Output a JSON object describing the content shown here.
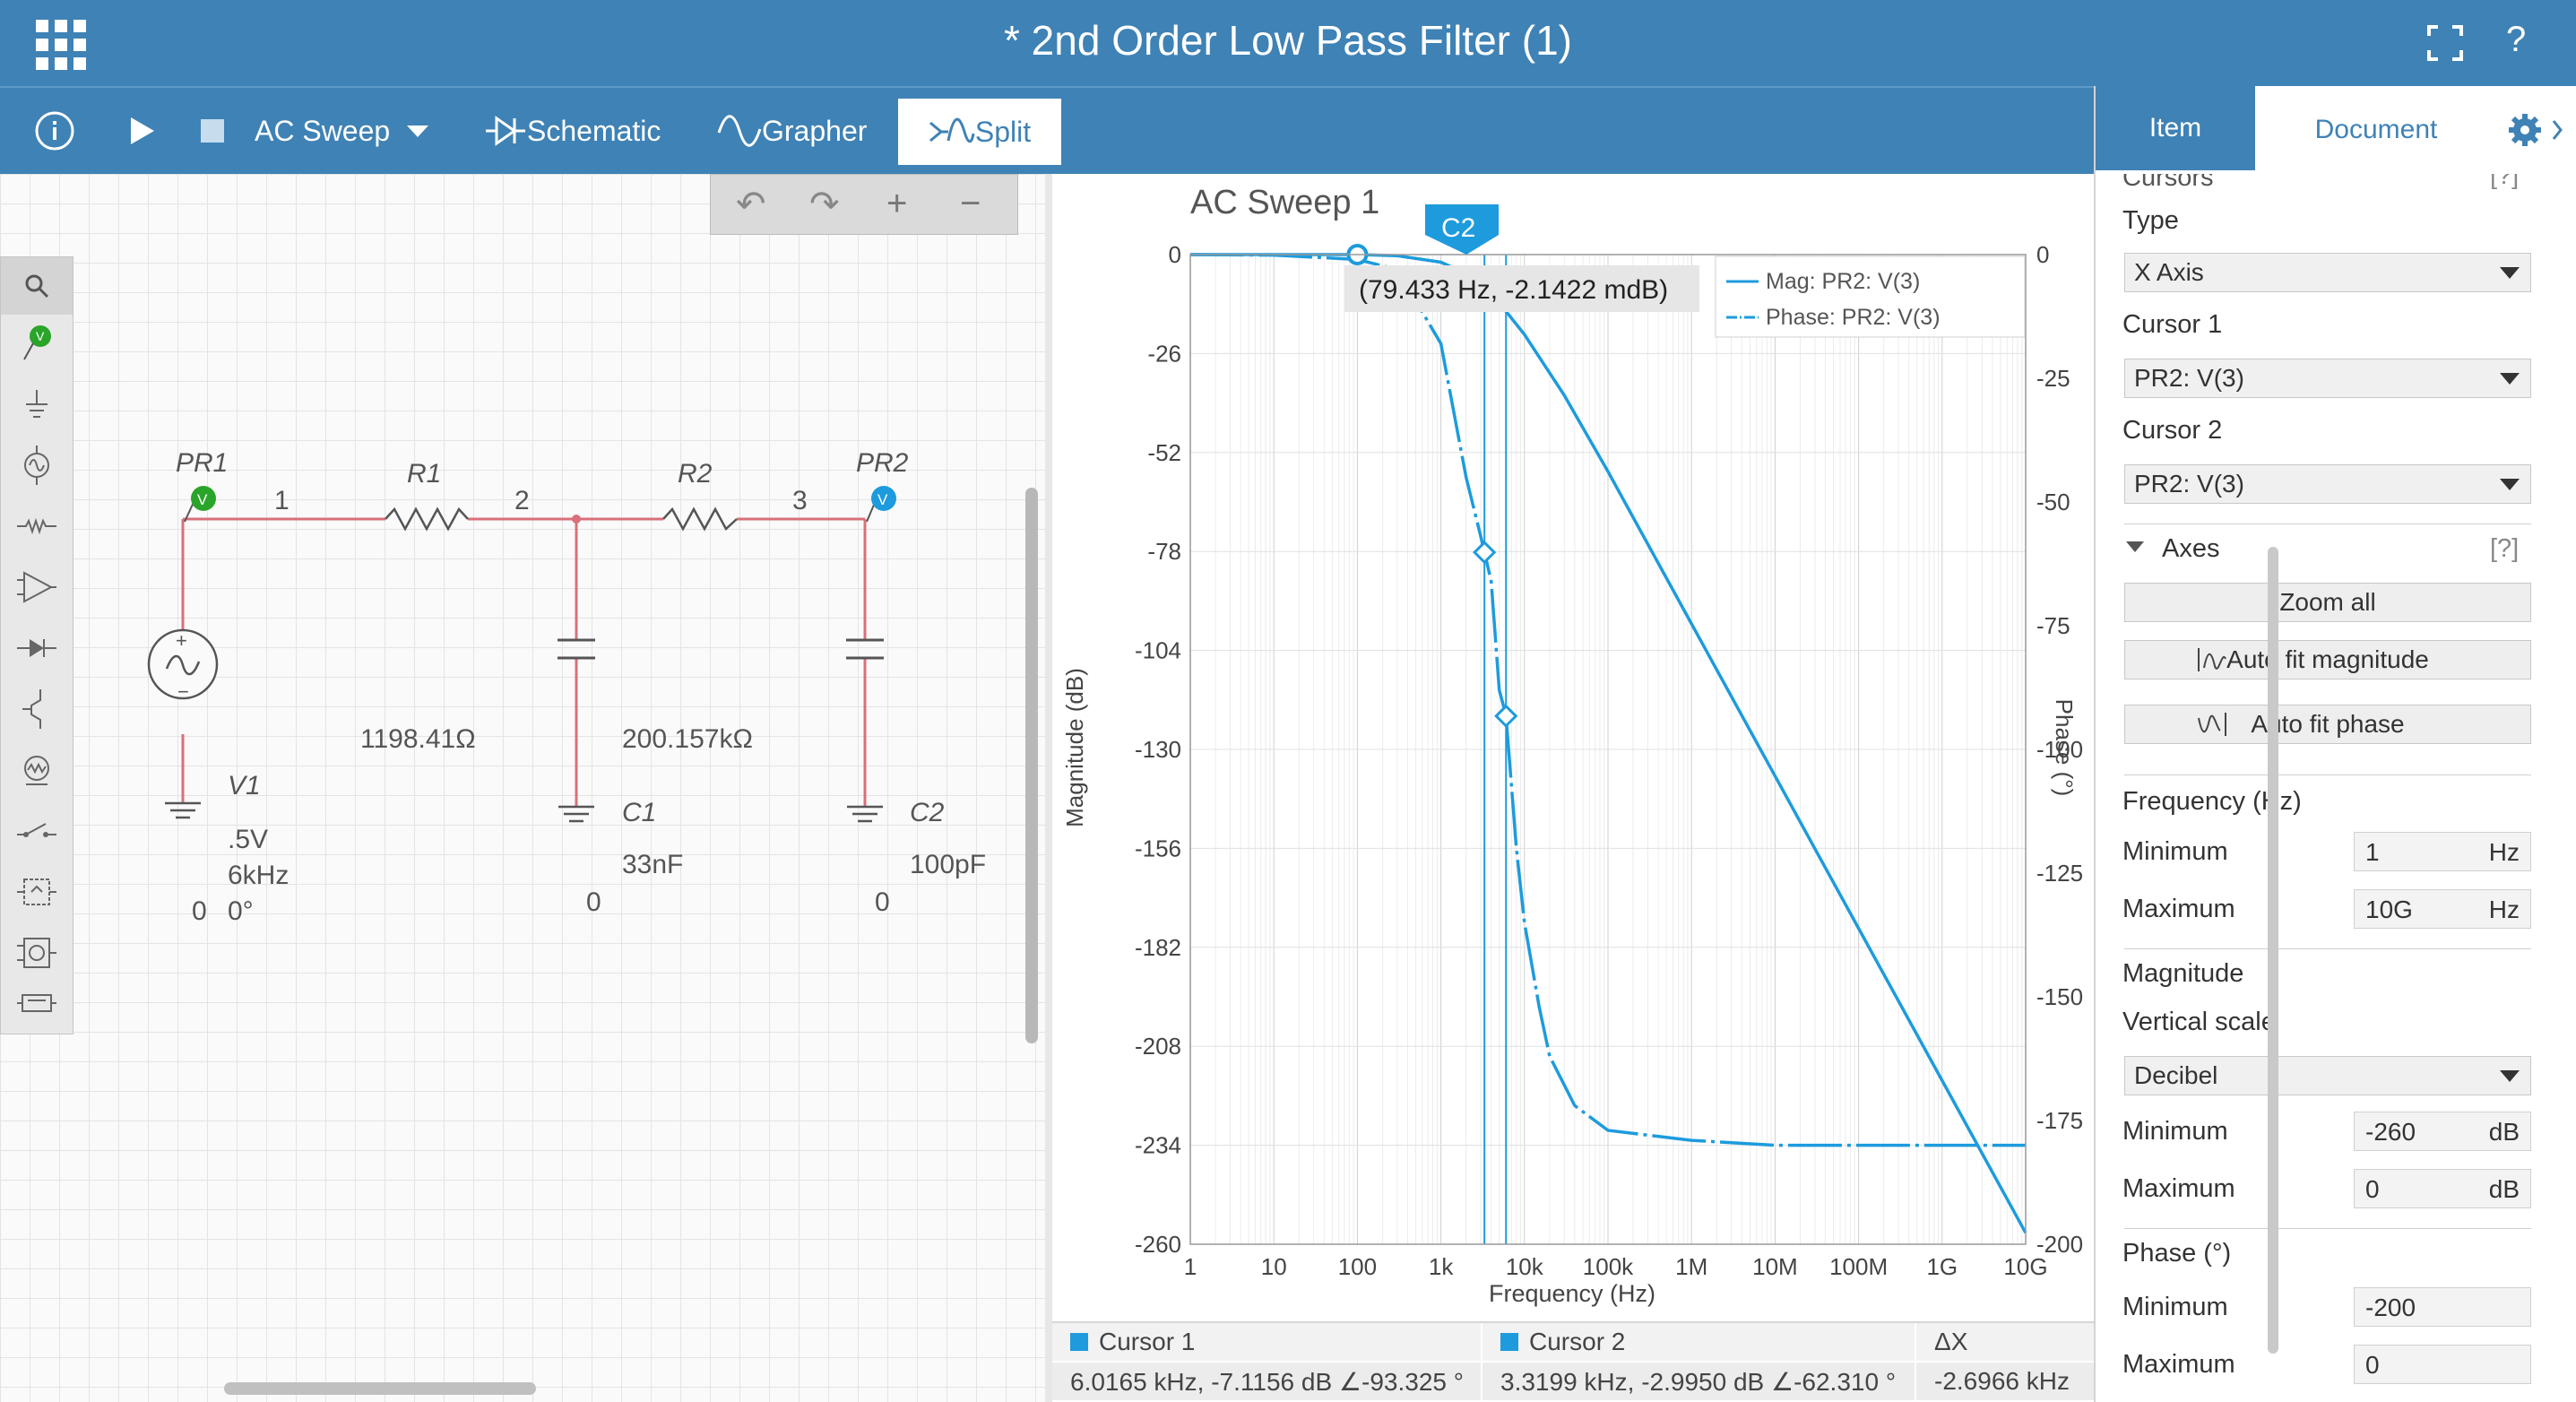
{
  "app": {
    "title": "* 2nd Order Low Pass Filter (1)",
    "help_label": "?"
  },
  "toolbar": {
    "analysis_label": "AC Sweep",
    "schematic_label": "Schematic",
    "grapher_label": "Grapher",
    "split_label": "Split"
  },
  "schematic": {
    "probes": [
      "PR1",
      "PR2"
    ],
    "probe_marker": "V",
    "nodes": [
      "1",
      "2",
      "3",
      "0",
      "0",
      "0"
    ],
    "r1": {
      "name": "R1",
      "value": "1198.41Ω"
    },
    "r2": {
      "name": "R2",
      "value": "200.157kΩ"
    },
    "c1": {
      "name": "C1",
      "value": "33nF"
    },
    "c2": {
      "name": "C2",
      "value": "100pF"
    },
    "v1": {
      "name": "V1",
      "amplitude": ".5V",
      "frequency": "6kHz",
      "phase": "0°"
    }
  },
  "grapher": {
    "title": "AC Sweep 1",
    "cursor_tag": "C2",
    "tooltip": "(79.433 Hz, -2.1422 mdB)",
    "legend": [
      "Mag: PR2: V(3)",
      "Phase: PR2: V(3)"
    ],
    "left_ticks": [
      "0",
      "-26",
      "-52",
      "-78",
      "-104",
      "-130",
      "-156",
      "-182",
      "-208",
      "-234",
      "-260"
    ],
    "right_ticks": [
      "0",
      "-25",
      "-50",
      "-75",
      "-100",
      "-125",
      "-150",
      "-175",
      "-200"
    ],
    "x_ticks": [
      "1",
      "10",
      "100",
      "1k",
      "10k",
      "100k",
      "1M",
      "10M",
      "100M",
      "1G",
      "10G"
    ],
    "xlabel": "Frequency (Hz)",
    "ylabel_left": "Magnitude (dB)",
    "ylabel_right": "Phase (°)",
    "cursor_table": {
      "c1_header": "Cursor 1",
      "c2_header": "Cursor 2",
      "dx_header": "ΔX",
      "c1_value": "6.0165 kHz, -7.1156 dB ∠-93.325 °",
      "c2_value": "3.3199 kHz, -2.9950 dB ∠-62.310 °",
      "dx_value": "-2.6966 kHz"
    }
  },
  "chart_data": {
    "type": "line",
    "title": "AC Sweep 1",
    "xlabel": "Frequency (Hz)",
    "ylabel": "Magnitude (dB)",
    "y2label": "Phase (°)",
    "x_scale": "log",
    "xlim": [
      1,
      10000000000
    ],
    "ylim": [
      -260,
      0
    ],
    "y2lim": [
      -200,
      0
    ],
    "grid": true,
    "legend_position": "top-right",
    "series": [
      {
        "name": "Mag: PR2: V(3)",
        "axis": "left",
        "x": [
          1,
          10,
          100,
          300,
          1000,
          2000,
          4000,
          10000,
          30000,
          100000,
          1000000,
          10000000,
          100000000,
          1000000000,
          10000000000
        ],
        "y": [
          0,
          0,
          0,
          -0.3,
          -2,
          -5,
          -10,
          -21,
          -37,
          -57,
          -97,
          -137,
          -177,
          -217,
          -257
        ]
      },
      {
        "name": "Phase: PR2: V(3)",
        "axis": "right",
        "x": [
          1,
          10,
          100,
          300,
          1000,
          2000,
          3000,
          4000,
          5000,
          6000,
          8000,
          10000,
          15000,
          20000,
          40000,
          100000,
          1000000,
          10000000,
          100000000,
          1000000000,
          10000000000
        ],
        "y": [
          0,
          -0.1,
          -1,
          -3,
          -18,
          -45,
          -57,
          -66,
          -88,
          -93,
          -120,
          -135,
          -152,
          -162,
          -172,
          -177,
          -179,
          -180,
          -180,
          -180,
          -180
        ]
      }
    ],
    "cursors": [
      {
        "name": "Cursor 1",
        "x": 6016.5
      },
      {
        "name": "Cursor 2",
        "x": 3319.9
      }
    ]
  },
  "panel": {
    "tabs": [
      "Item",
      "Document"
    ],
    "cursors_section_label": "Cursors",
    "help_marker": "[?]",
    "type_label": "Type",
    "type_value": "X Axis",
    "cursor1_label": "Cursor 1",
    "cursor1_value": "PR2: V(3)",
    "cursor2_label": "Cursor 2",
    "cursor2_value": "PR2: V(3)",
    "axes_label": "Axes",
    "zoom_all": "Zoom all",
    "auto_fit_magnitude": "Auto fit magnitude",
    "auto_fit_phase": "Auto fit phase",
    "frequency_label": "Frequency (Hz)",
    "minimum_label": "Minimum",
    "maximum_label": "Maximum",
    "freq_min": "1",
    "freq_max": "10G",
    "freq_unit": "Hz",
    "magnitude_label": "Magnitude",
    "vertical_scale_label": "Vertical scale",
    "vertical_scale_value": "Decibel",
    "mag_min": "-260",
    "mag_max": "0",
    "mag_unit": "dB",
    "phase_label": "Phase (°)",
    "phase_min": "-200",
    "phase_max": "0"
  },
  "colors": {
    "header": "#3f82b5",
    "trace": "#1d9bdd",
    "wire": "#d9707a",
    "probe_pr1": "#2aa52a",
    "probe_pr2": "#1d9bdd"
  }
}
